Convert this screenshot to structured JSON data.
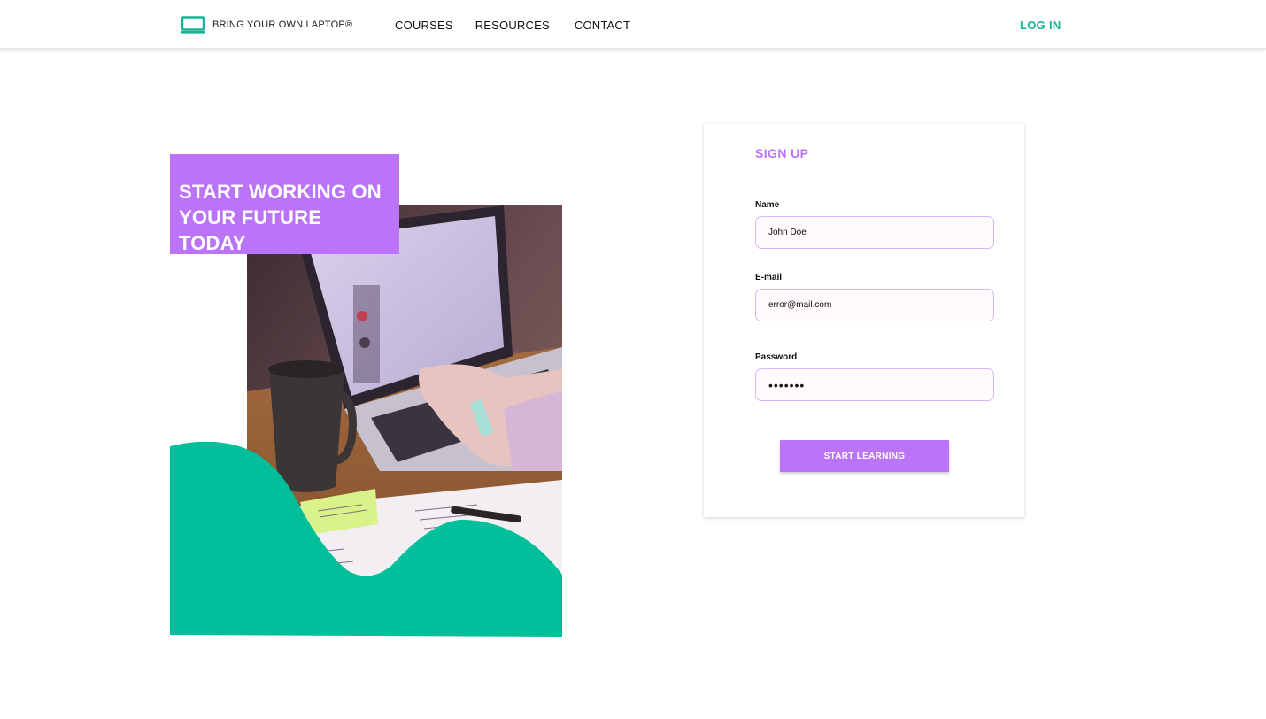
{
  "colors": {
    "accent_purple": "#bb73f8",
    "accent_teal": "#00bf9a",
    "brand_teal": "#16b394"
  },
  "header": {
    "brand_text": "BRING YOUR OWN LAPTOP®",
    "nav": [
      "COURSES",
      "RESOURCES",
      "CONTACT"
    ],
    "login_label": "LOG IN"
  },
  "hero": {
    "headline_line1": "START WORKING ON",
    "headline_line2": "YOUR FUTURE TODAY"
  },
  "signup": {
    "title": "SIGN UP",
    "name_label": "Name",
    "name_value": "John Doe",
    "email_label": "E-mail",
    "email_value": "error@mail.com",
    "password_label": "Password",
    "password_value": "•••••••",
    "submit_label": "START LEARNING"
  }
}
